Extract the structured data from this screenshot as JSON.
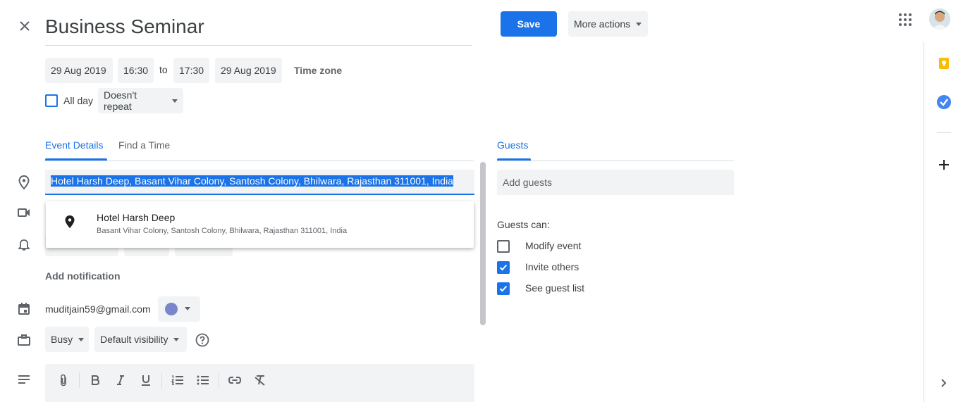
{
  "header": {
    "title": "Business Seminar",
    "save_label": "Save",
    "more_actions_label": "More actions"
  },
  "datetime": {
    "start_date": "29 Aug 2019",
    "start_time": "16:30",
    "to_label": "to",
    "end_time": "17:30",
    "end_date": "29 Aug 2019",
    "timezone_label": "Time zone",
    "allday_label": "All day",
    "repeat_label": "Doesn't repeat"
  },
  "tabs": {
    "event_details": "Event Details",
    "find_time": "Find a Time",
    "guests": "Guests"
  },
  "location": {
    "value": "Hotel Harsh Deep, Basant Vihar Colony, Santosh Colony, Bhilwara, Rajasthan 311001, India"
  },
  "suggestion": {
    "name": "Hotel Harsh Deep",
    "address": "Basant Vihar Colony, Santosh Colony, Bhilwara, Rajasthan 311001, India"
  },
  "notification": {
    "add_label": "Add notification"
  },
  "calendar": {
    "owner": "muditjain59@gmail.com",
    "color": "#7986cb"
  },
  "availability": {
    "busy_label": "Busy",
    "visibility_label": "Default visibility"
  },
  "guests": {
    "add_placeholder": "Add guests",
    "can_label": "Guests can:",
    "permissions": [
      {
        "label": "Modify event",
        "checked": false
      },
      {
        "label": "Invite others",
        "checked": true
      },
      {
        "label": "See guest list",
        "checked": true
      }
    ]
  },
  "colors": {
    "accent": "#1a73e8",
    "keep_yellow": "#fbbc04",
    "selection": "#1a73e8"
  }
}
